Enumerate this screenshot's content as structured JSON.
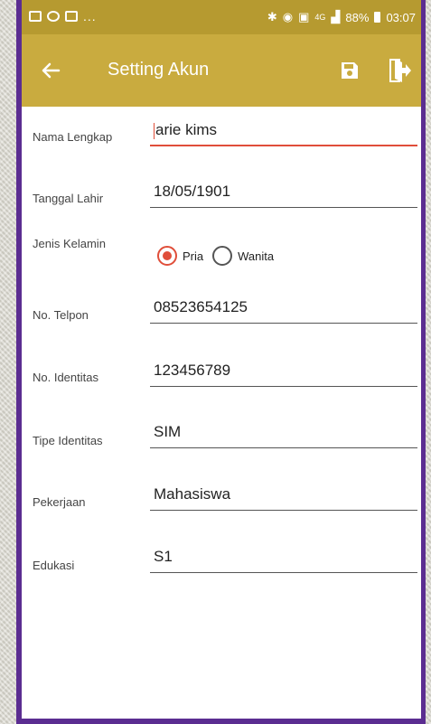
{
  "status_bar": {
    "notification_icons": [
      "image-icon",
      "whatsapp-icon",
      "gallery-icon"
    ],
    "overflow": "...",
    "network": "4G",
    "battery": "88%",
    "time": "03:07"
  },
  "toolbar": {
    "title": "Setting Akun",
    "back_icon": "arrow-left-icon",
    "save_icon": "save-icon",
    "logout_icon": "logout-icon",
    "color": "#c9ab3f"
  },
  "form": {
    "nama": {
      "label": "Nama Lengkap",
      "value": "arie kims"
    },
    "tanggal": {
      "label": "Tanggal Lahir",
      "value": "18/05/1901"
    },
    "gender": {
      "label": "Jenis Kelamin",
      "options": [
        "Pria",
        "Wanita"
      ],
      "selected": "Pria"
    },
    "telpon": {
      "label": "No. Telpon",
      "value": "08523654125"
    },
    "identitas": {
      "label": "No. Identitas",
      "value": "123456789"
    },
    "tipe": {
      "label": "Tipe Identitas",
      "value": "SIM"
    },
    "pekerjaan": {
      "label": "Pekerjaan",
      "value": "Mahasiswa"
    },
    "edukasi": {
      "label": "Edukasi",
      "value": "S1"
    }
  },
  "colors": {
    "accent": "#e04e3a",
    "frame": "#5b2d91"
  }
}
